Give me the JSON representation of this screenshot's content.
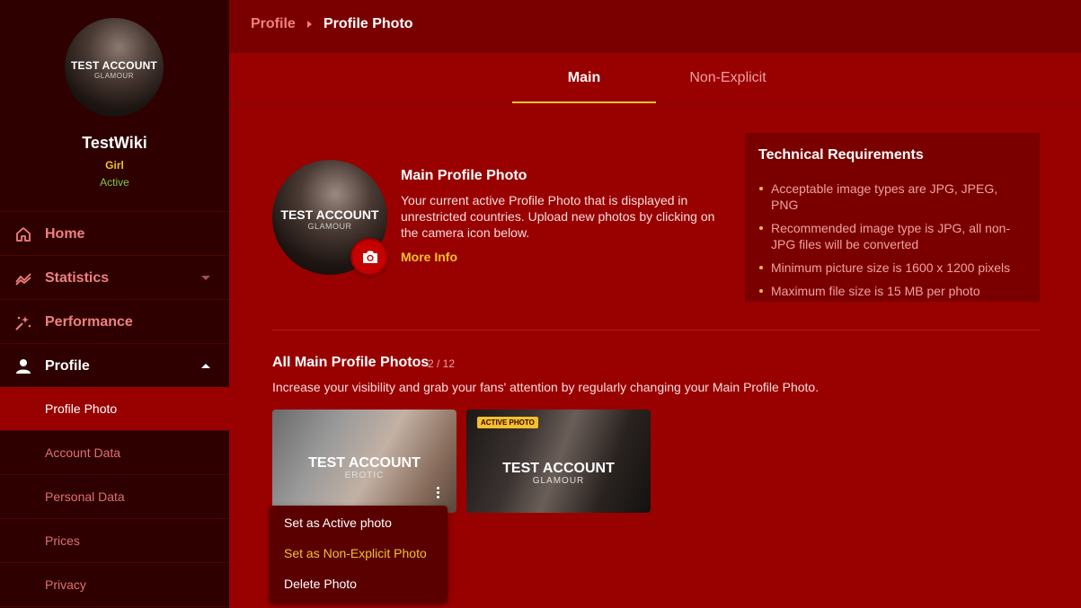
{
  "sidebar": {
    "avatar_text": "TEST ACCOUNT",
    "avatar_subtext": "GLAMOUR",
    "username": "TestWiki",
    "gender": "Girl",
    "status": "Active",
    "nav": [
      {
        "label": "Home",
        "icon": "home-icon"
      },
      {
        "label": "Statistics",
        "icon": "statistics-icon"
      },
      {
        "label": "Performance",
        "icon": "performance-icon"
      },
      {
        "label": "Profile",
        "icon": "user-icon"
      }
    ],
    "sub": [
      {
        "label": "Profile Photo"
      },
      {
        "label": "Account Data"
      },
      {
        "label": "Personal Data"
      },
      {
        "label": "Prices"
      },
      {
        "label": "Privacy"
      }
    ]
  },
  "breadcrumb": {
    "parent": "Profile",
    "current": "Profile Photo"
  },
  "tabs": {
    "main": "Main",
    "non_explicit": "Non-Explicit"
  },
  "main_photo": {
    "overlay_text": "TEST ACCOUNT",
    "overlay_subtext": "GLAMOUR",
    "title": "Main Profile Photo",
    "description": "Your current active Profile Photo that is displayed in unrestricted countries. Upload new photos by clicking on the camera icon below.",
    "more_info": "More Info"
  },
  "tech": {
    "title": "Technical Requirements",
    "items": [
      "Acceptable image types are JPG, JPEG, PNG",
      "Recommended image type is JPG, all non-JPG files will be converted",
      "Minimum picture size is 1600 x 1200 pixels",
      "Maximum file size is 15 MB per photo"
    ]
  },
  "gallery": {
    "title": "All Main Profile Photos",
    "count": "2 / 12",
    "description": "Increase your visibility and grab your fans' attention by regularly changing your Main Profile Photo.",
    "photos": [
      {
        "text": "TEST ACCOUNT",
        "subtext": "EROTIC"
      },
      {
        "text": "TEST ACCOUNT",
        "subtext": "GLAMOUR",
        "badge": "ACTIVE PHOTO"
      }
    ],
    "menu": [
      "Set as Active photo",
      "Set as Non-Explicit Photo",
      "Delete Photo"
    ]
  },
  "colors": {
    "background": "#990000",
    "sidebar": "#2e0000",
    "accent": "#f2c12e",
    "active_green": "#7ec943"
  }
}
